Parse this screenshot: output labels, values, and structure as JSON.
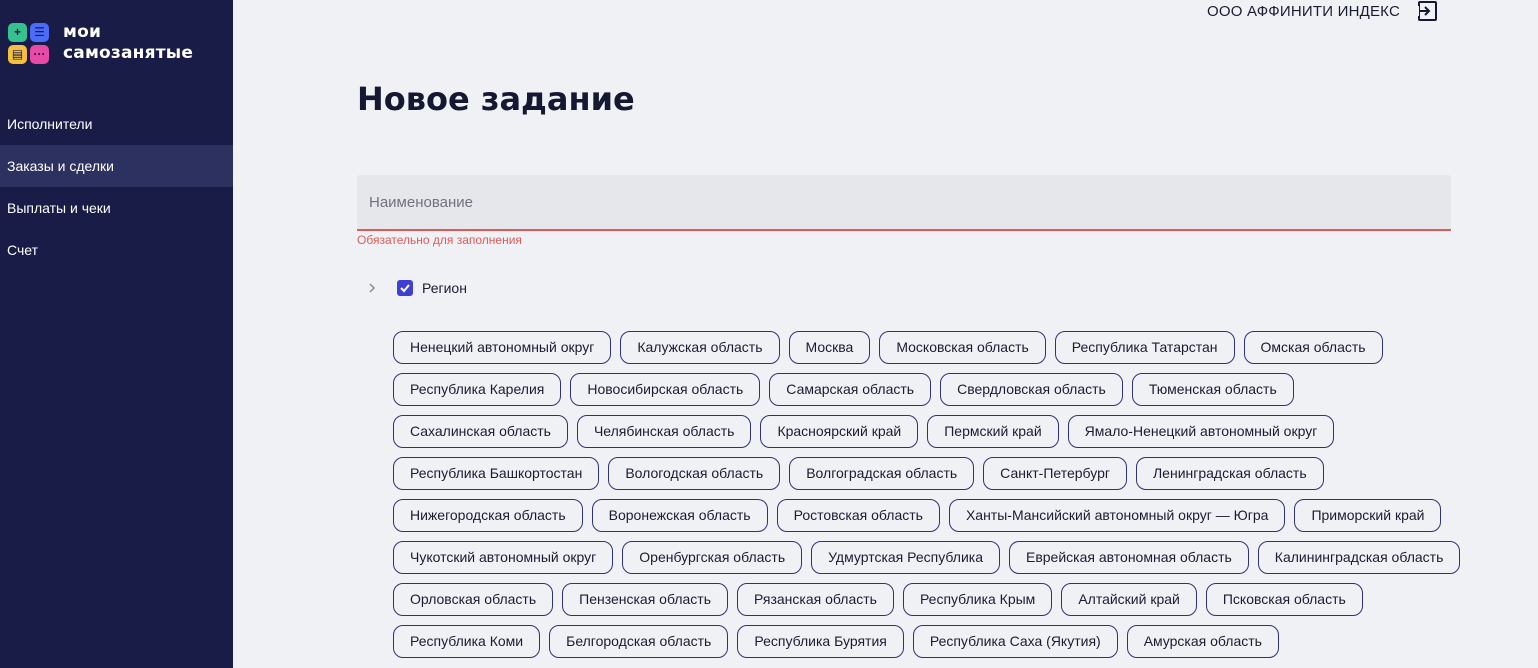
{
  "brand": {
    "line1": "мои",
    "line2": "самозанятые",
    "tiles": [
      {
        "glyph": "+",
        "color": "#35c28f",
        "icon": "plus-icon"
      },
      {
        "glyph": "☰",
        "color": "#4a6cf7",
        "icon": "list-icon"
      },
      {
        "glyph": "▤",
        "color": "#f5c042",
        "icon": "document-icon"
      },
      {
        "glyph": "···",
        "color": "#e84aa8",
        "icon": "chat-dots-icon"
      }
    ]
  },
  "sidebar": {
    "items": [
      {
        "label": "Исполнители",
        "active": false
      },
      {
        "label": "Заказы и сделки",
        "active": true
      },
      {
        "label": "Выплаты и чеки",
        "active": false
      },
      {
        "label": "Счет",
        "active": false
      }
    ]
  },
  "header": {
    "company": "ООО АФФИНИТИ ИНДЕКС",
    "logout_icon": "logout-icon"
  },
  "page": {
    "title": "Новое задание"
  },
  "form": {
    "name_field": {
      "placeholder": "Наименование",
      "value": "",
      "error": "Обязательно для заполнения"
    },
    "region": {
      "label": "Регион",
      "checked": true,
      "expand_icon": "chevron-right-icon",
      "check_icon": "checkmark-icon"
    },
    "regions": [
      "Ненецкий автономный округ",
      "Калужская область",
      "Москва",
      "Московская область",
      "Республика Татарстан",
      "Омская область",
      "Республика Карелия",
      "Новосибирская область",
      "Самарская область",
      "Свердловская область",
      "Тюменская область",
      "Сахалинская область",
      "Челябинская область",
      "Красноярский край",
      "Пермский край",
      "Ямало-Ненецкий автономный округ",
      "Республика Башкортостан",
      "Вологодская область",
      "Волгоградская область",
      "Санкт-Петербург",
      "Ленинградская область",
      "Нижегородская область",
      "Воронежская область",
      "Ростовская область",
      "Ханты-Мансийский автономный округ — Югра",
      "Приморский край",
      "Чукотский автономный округ",
      "Оренбургская область",
      "Удмуртская Республика",
      "Еврейская автономная область",
      "Калининградская область",
      "Орловская область",
      "Пензенская область",
      "Рязанская область",
      "Республика Крым",
      "Алтайский край",
      "Псковская область",
      "Республика Коми",
      "Белгородская область",
      "Республика Бурятия",
      "Республика Саха (Якутия)",
      "Амурская область"
    ]
  },
  "colors": {
    "sidebar_bg": "#181c47",
    "sidebar_active": "#2d3160",
    "accent": "#3f3fd1",
    "error": "#e05a5a",
    "chip_border": "#2f327a"
  }
}
